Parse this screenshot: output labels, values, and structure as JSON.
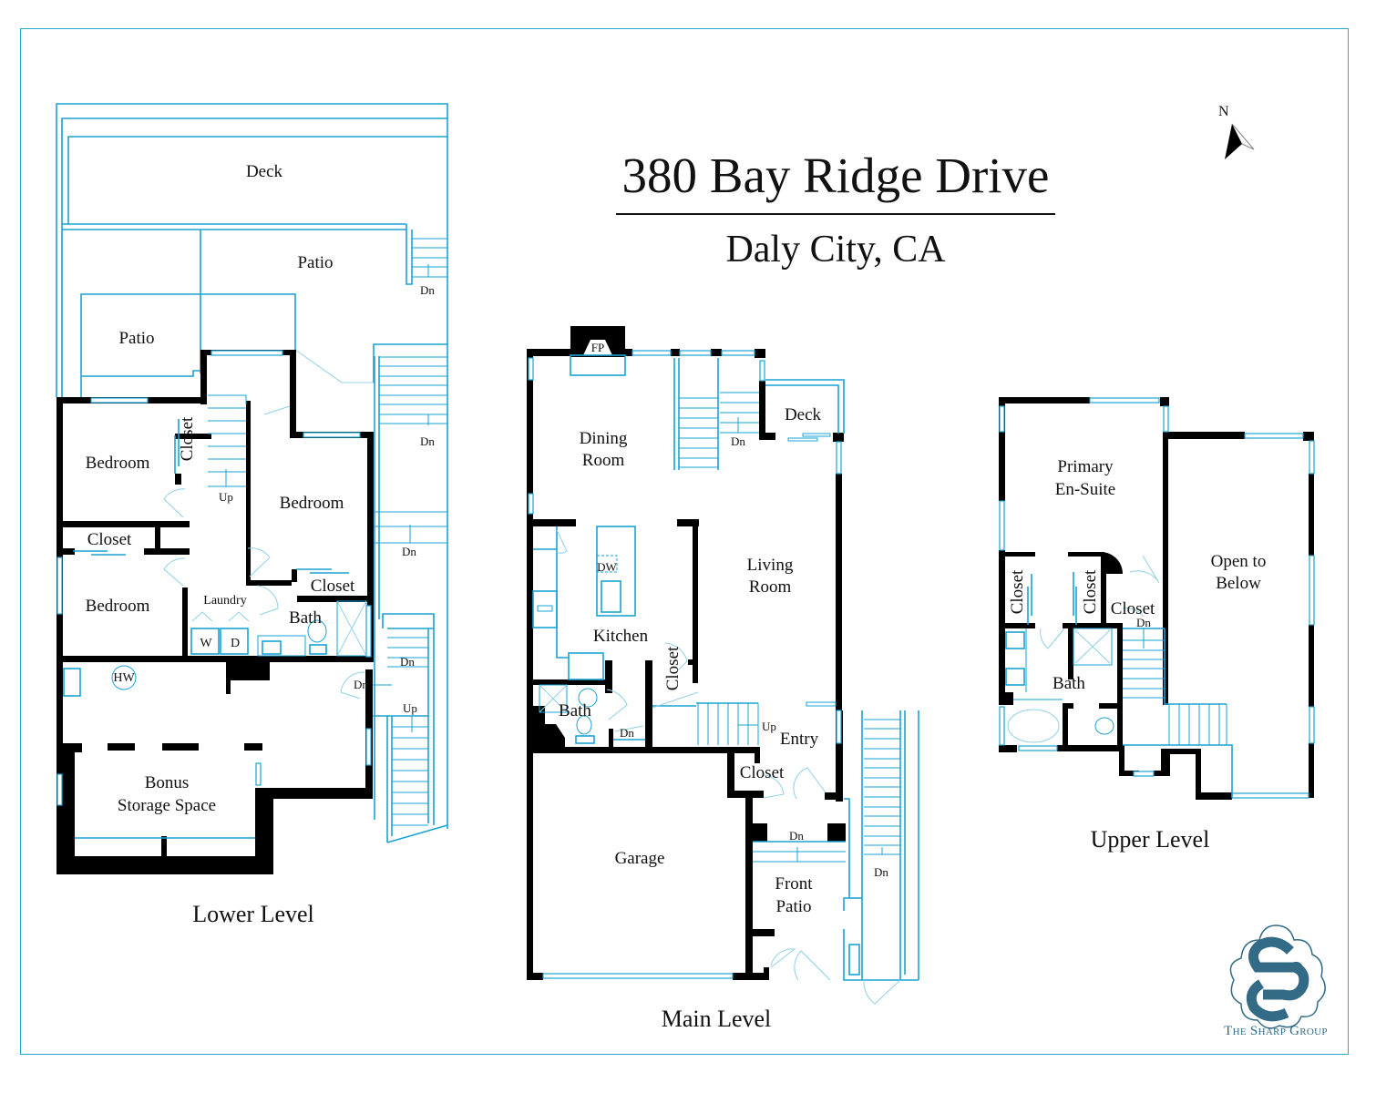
{
  "header": {
    "title": "380 Bay Ridge Drive",
    "subtitle": "Daly City, CA"
  },
  "compass": {
    "label": "N",
    "icon": "north-arrow-icon"
  },
  "brand": {
    "name": "The Sharp Group",
    "icon": "sharp-group-logo-icon",
    "color": "#336b86"
  },
  "colors": {
    "border": "#2aa7d1",
    "fixture_lines": "#1aa3d4",
    "walls": "#000000"
  },
  "levels": {
    "lower": {
      "label": "Lower Level",
      "rooms": {
        "deck": "Deck",
        "patio_upper": "Patio",
        "patio_left": "Patio",
        "bedroom_1": "Bedroom",
        "closet_1": "Closet",
        "bedroom_2": "Bedroom",
        "closet_2": "Closet",
        "bedroom_3": "Bedroom",
        "closet_3": "Closet",
        "laundry": "Laundry",
        "bath": "Bath",
        "bonus": "Bonus",
        "bonus_2": "Storage Space"
      },
      "fixtures": {
        "washer": "W",
        "dryer": "D",
        "water_heater": "HW"
      },
      "stairs": {
        "dn_1": "Dn",
        "dn_2": "Dn",
        "dn_3": "Dn",
        "dn_4": "Dn",
        "dn_5": "Dn",
        "up_1": "Up",
        "up_2": "Up"
      }
    },
    "main": {
      "label": "Main Level",
      "rooms": {
        "fireplace": "FP",
        "dining_1": "Dining",
        "dining_2": "Room",
        "deck": "Deck",
        "living_1": "Living",
        "living_2": "Room",
        "kitchen": "Kitchen",
        "closet_1": "Closet",
        "bath": "Bath",
        "entry": "Entry",
        "closet_2": "Closet",
        "garage": "Garage",
        "front_patio_1": "Front",
        "front_patio_2": "Patio"
      },
      "fixtures": {
        "dishwasher": "DW"
      },
      "stairs": {
        "dn_1": "Dn",
        "dn_2": "Dn",
        "dn_3": "Dn",
        "dn_4": "Dn",
        "up_1": "Up"
      }
    },
    "upper": {
      "label": "Upper Level",
      "rooms": {
        "primary_1": "Primary",
        "primary_2": "En-Suite",
        "open_1": "Open to",
        "open_2": "Below",
        "closet_1": "Closet",
        "closet_2": "Closet",
        "closet_3": "Closet",
        "bath": "Bath"
      },
      "stairs": {
        "dn_1": "Dn"
      }
    }
  }
}
